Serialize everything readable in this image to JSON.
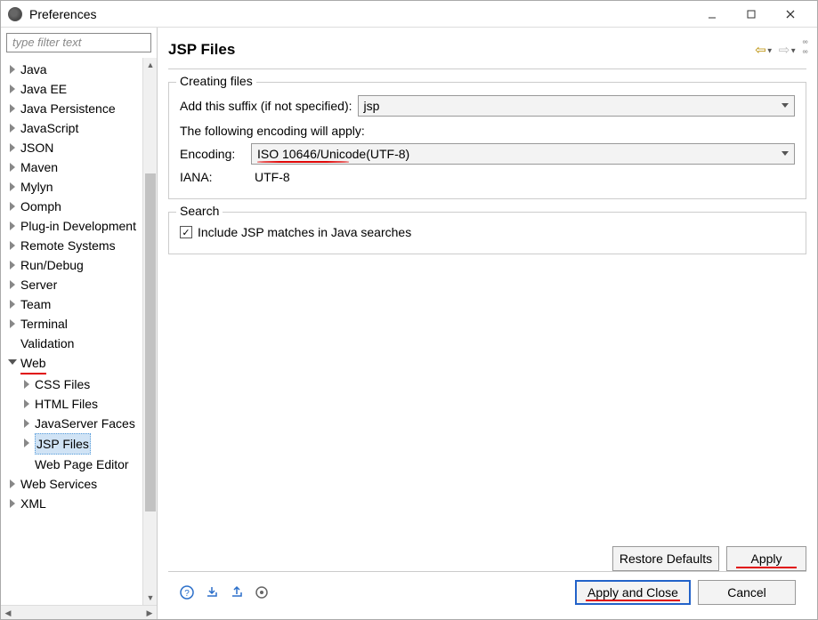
{
  "window": {
    "title": "Preferences"
  },
  "sidebar": {
    "filter_placeholder": "type filter text",
    "items": [
      "Java",
      "Java EE",
      "Java Persistence",
      "JavaScript",
      "JSON",
      "Maven",
      "Mylyn",
      "Oomph",
      "Plug-in Development",
      "Remote Systems",
      "Run/Debug",
      "Server",
      "Team",
      "Terminal",
      "Validation"
    ],
    "web_label": "Web",
    "web_children": [
      "CSS Files",
      "HTML Files",
      "JavaServer Faces",
      "JSP Files",
      "Web Page Editor"
    ],
    "tail_items": [
      "Web Services",
      "XML"
    ]
  },
  "page": {
    "title": "JSP Files",
    "group_creating": "Creating files",
    "suffix_label": "Add this suffix (if not specified):",
    "suffix_value": "jsp",
    "encoding_note": "The following encoding will apply:",
    "encoding_label": "Encoding:",
    "encoding_value": "ISO 10646/Unicode(UTF-8)",
    "iana_label": "IANA:",
    "iana_value": "UTF-8",
    "group_search": "Search",
    "search_checkbox": "Include JSP matches in Java searches"
  },
  "buttons": {
    "restore_defaults": "Restore Defaults",
    "apply": "Apply",
    "apply_close": "Apply and Close",
    "cancel": "Cancel"
  }
}
